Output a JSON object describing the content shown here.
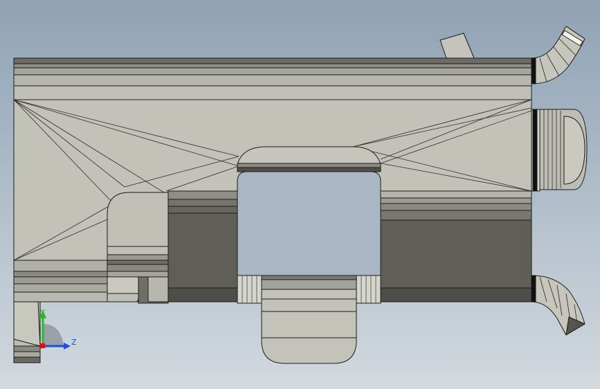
{
  "viewport": {
    "background_top": "#8fa2b4",
    "background_bottom": "#d2d9df"
  },
  "model": {
    "base_color": "#c1c1b8",
    "shadow_color": "#5f5f57",
    "edge_color": "#1a1a1a"
  },
  "triad": {
    "y_label": "Y",
    "z_label": "Z",
    "y_color": "#22bb22",
    "z_color": "#1a4fd6",
    "x_color": "#dd1111"
  }
}
